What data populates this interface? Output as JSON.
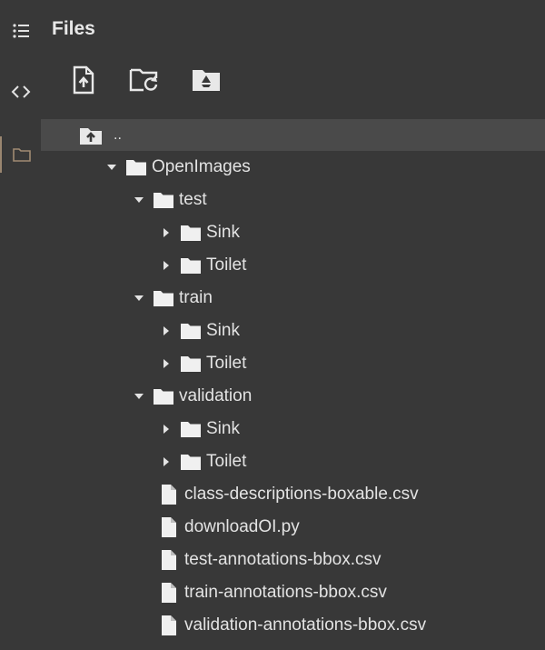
{
  "panel": {
    "title": "Files"
  },
  "rail": {
    "items": [
      {
        "icon": "table-of-contents-icon"
      },
      {
        "icon": "code-icon"
      },
      {
        "icon": "folder-icon",
        "active": true
      }
    ]
  },
  "toolbar": {
    "buttons": [
      {
        "icon": "upload-file-icon"
      },
      {
        "icon": "refresh-folder-icon"
      },
      {
        "icon": "mount-drive-icon"
      }
    ]
  },
  "tree": {
    "parent_label": "..",
    "root": {
      "label": "OpenImages",
      "expanded": true
    },
    "test": {
      "label": "test",
      "expanded": true
    },
    "test_sink": {
      "label": "Sink"
    },
    "test_toilet": {
      "label": "Toilet"
    },
    "train": {
      "label": "train",
      "expanded": true
    },
    "train_sink": {
      "label": "Sink"
    },
    "train_toilet": {
      "label": "Toilet"
    },
    "validation": {
      "label": "validation",
      "expanded": true
    },
    "validation_sink": {
      "label": "Sink"
    },
    "validation_toilet": {
      "label": "Toilet"
    },
    "files": [
      "class-descriptions-boxable.csv",
      "downloadOI.py",
      "test-annotations-bbox.csv",
      "train-annotations-bbox.csv",
      "validation-annotations-bbox.csv"
    ]
  }
}
